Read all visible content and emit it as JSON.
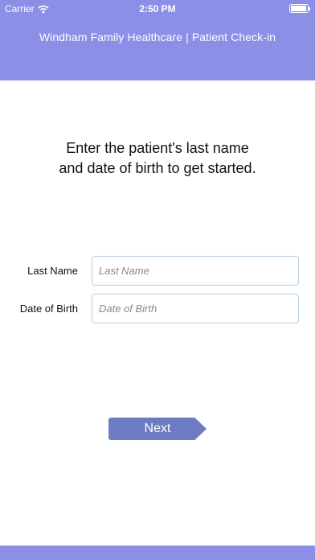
{
  "status_bar": {
    "carrier": "Carrier",
    "time": "2:50 PM",
    "icons": [
      "wifi-icon",
      "battery-icon"
    ]
  },
  "header": {
    "title": "Windham Family Healthcare | Patient Check-in"
  },
  "prompt": {
    "line1": "Enter the patient's last name",
    "line2": "and date of birth to get started."
  },
  "form": {
    "last_name": {
      "label": "Last Name",
      "placeholder": "Last Name",
      "value": ""
    },
    "dob": {
      "label": "Date of Birth",
      "placeholder": "Date of Birth",
      "value": ""
    }
  },
  "actions": {
    "next_label": "Next"
  },
  "colors": {
    "header_bg": "#8b90e6",
    "button_bg": "#6d7cc2",
    "input_border": "#b9cfe3"
  }
}
